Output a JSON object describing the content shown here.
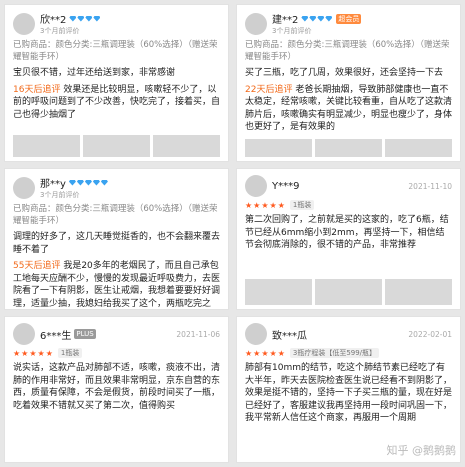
{
  "card1": {
    "name": "欣**2",
    "time": "3个月前评价",
    "spec": "已购商品：颜色分类:三瓶调理装（60%选择）（赠送荣耀智能手环）",
    "text": "宝贝很不错，过年还给送到家，非常感谢",
    "follow_tag": "16天后追评",
    "follow_text": "效果还是比较明显，咳嗽轻不少了，以前的呼吸问题到了不少改善，快吃完了，接着买，自己也得少抽烟了"
  },
  "card2": {
    "name": "建**2",
    "badge": "超会员",
    "time": "3个月前评价",
    "spec": "已购商品：颜色分类:三瓶调理装（60%选择）（赠送荣耀智能手环）",
    "text": "买了三瓶，吃了几周，效果很好，还会坚持一下去",
    "follow_tag": "22天后追评",
    "follow_text": "老爸长期抽烟，导致肺部健康也一直不太稳定，经常咳嗽，关键比较看重，自从吃了这款清肺片后，咳嗽确实有明显减少，明显也瘦少了，身体也更好了，是有效果的"
  },
  "card3": {
    "name": "那**y",
    "time": "3个月前评价",
    "spec": "已购商品：颜色分类:三瓶调理装（60%选择）（赠送荣耀智能手环）",
    "text": "调理的好多了，这几天睡觉挺香的，也不会翻来覆去睡不着了",
    "follow_tag": "55天后追评",
    "follow_text": "我是20多年的老烟民了，而且自己承包工地每天应酬不少，慢慢的发现最近呼吸费力，去医院看了一下有阴影，医生让戒烟，我想着要要好好调理，适量少抽，我媳妇给我买了这个，两瓶吃完之后，效果还不错，"
  },
  "card4": {
    "name": "Y***9",
    "date": "2021-11-10",
    "pill": "1瓶装",
    "text": "第二次回购了，之前就是买的这家的，吃了6瓶，结节已经从6mm缩小到2mm，再坚持一下，相信结节会彻底消除的，很不错的产品，非常推荐"
  },
  "card5": {
    "name": "6***生",
    "badge": "PLUS",
    "date": "2021-11-06",
    "pill": "1瓶装",
    "text": "说实话，这款产品对肺部不适，咳嗽，痰液不出，清肺的作用非常好，而且效果非常明显，京东自营的东西，质量有保障，不会是假货，前段时间买了一瓶，吃着效果不错就又买了第二次，值得购买"
  },
  "card6": {
    "name": "致***瓜",
    "date": "2022-02-01",
    "pill": "3瓶疗程装【低至599/瓶】",
    "text": "肺部有10mm的结节，吃这个肺结节素已经吃了有大半年，昨天去医院检查医生说已经看不到阴影了，效果是挺不错的，坚持一下子买三瓶的量，现在好是已经好了，客服建议我再坚持用一段时间巩固一下，我平常新人信任这个商家，再服用一个周期"
  },
  "watermark": "知乎 @鹅鹅鹅"
}
